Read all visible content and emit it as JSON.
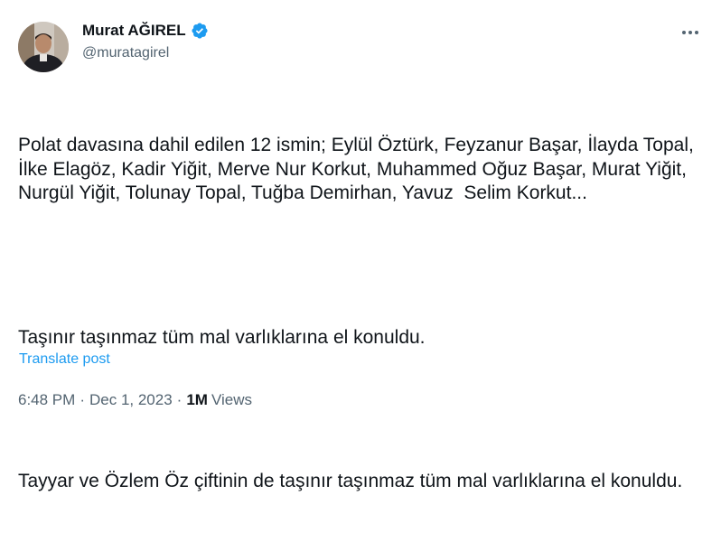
{
  "author": {
    "display_name": "Murat AĞIREL",
    "handle": "@muratagirel",
    "verified": true
  },
  "post": {
    "paragraphs": [
      "Polat davasına dahil edilen 12 ismin; Eylül Öztürk, Feyzanur Başar, İlayda Topal, İlke Elagöz, Kadir Yiğit, Merve Nur Korkut, Muhammed Oğuz Başar, Murat Yiğit, Nurgül Yiğit, Tolunay Topal, Tuğba Demirhan, Yavuz  Selim Korkut...",
      "Taşınır taşınmaz tüm mal varlıklarına el konuldu.",
      "Tayyar ve Özlem Öz çiftinin de taşınır taşınmaz tüm mal varlıklarına el konuldu."
    ],
    "translate_label": "Translate post",
    "time": "6:48 PM",
    "date": "Dec 1, 2023",
    "separator": "·",
    "views_count": "1M",
    "views_label": "Views"
  },
  "icons": {
    "verified": "verified-badge-icon",
    "more": "more-options-icon"
  },
  "colors": {
    "accent": "#1d9bf0",
    "text": "#0f1419",
    "secondary": "#536471"
  }
}
